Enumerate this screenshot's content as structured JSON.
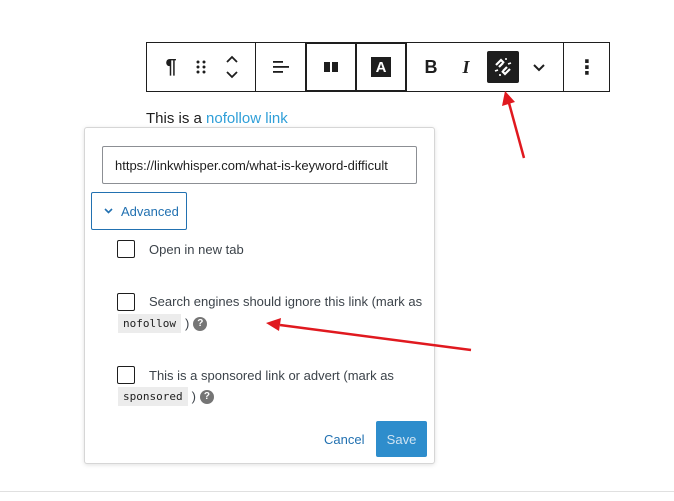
{
  "toolbar": {
    "paragraph_icon": "¶",
    "drag_icon": "⠿",
    "bold_label": "B",
    "italic_label": "I",
    "text_color_label": "A",
    "more_icon": "⋮"
  },
  "content": {
    "text_prefix": "This is a",
    "link_text": "nofollow link"
  },
  "link_popover": {
    "url_value": "https://linkwhisper.com/what-is-keyword-difficult",
    "advanced_label": "Advanced",
    "options": [
      {
        "label": "Open in new tab",
        "checked": false
      },
      {
        "label": "Search engines should ignore this link (mark as",
        "code": "nofollow",
        "suffix": ")",
        "checked": false
      },
      {
        "label": "This is a sponsored link or advert (mark as",
        "code": "sponsored",
        "suffix": ")",
        "checked": false
      }
    ],
    "cancel_label": "Cancel",
    "save_label": "Save"
  },
  "annotations": {
    "arrow_color": "#e0191f"
  },
  "colors": {
    "link": "#2f9fd8",
    "accent": "#2271b1",
    "save_bg": "#2e8dcc"
  }
}
